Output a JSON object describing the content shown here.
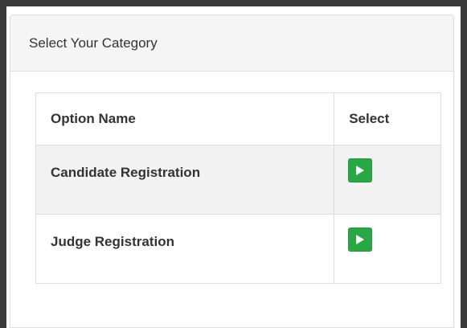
{
  "panel": {
    "title": "Select Your Category"
  },
  "table": {
    "headers": {
      "option_name": "Option Name",
      "select": "Select"
    },
    "rows": [
      {
        "label": "Candidate Registration",
        "action_icon": "play-icon"
      },
      {
        "label": "Judge Registration",
        "action_icon": "play-icon"
      }
    ]
  },
  "colors": {
    "button_green": "#28a745",
    "heading_bg": "#f5f5f5",
    "stripe_bg": "#f2f2f2",
    "border": "#dddddd",
    "text": "#333333"
  }
}
